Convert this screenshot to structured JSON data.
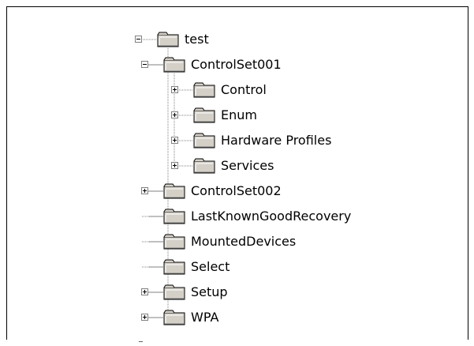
{
  "tree": {
    "items": [
      {
        "label": "test",
        "depth": 0,
        "state": "expanded"
      },
      {
        "label": "ControlSet001",
        "depth": 1,
        "state": "expanded"
      },
      {
        "label": "Control",
        "depth": 2,
        "state": "collapsed"
      },
      {
        "label": "Enum",
        "depth": 2,
        "state": "collapsed"
      },
      {
        "label": "Hardware Profiles",
        "depth": 2,
        "state": "collapsed"
      },
      {
        "label": "Services",
        "depth": 2,
        "state": "collapsed"
      },
      {
        "label": "ControlSet002",
        "depth": 1,
        "state": "collapsed"
      },
      {
        "label": "LastKnownGoodRecovery",
        "depth": 1,
        "state": "leaf"
      },
      {
        "label": "MountedDevices",
        "depth": 1,
        "state": "leaf"
      },
      {
        "label": "Select",
        "depth": 1,
        "state": "leaf"
      },
      {
        "label": "Setup",
        "depth": 1,
        "state": "collapsed"
      },
      {
        "label": "WPA",
        "depth": 1,
        "state": "collapsed"
      }
    ]
  },
  "icons": {
    "folder": "folder-icon",
    "expand": "plus-expander-icon",
    "collapse": "minus-expander-icon"
  },
  "colors": {
    "background": "#ffffff",
    "border": "#000000",
    "connector": "#808080",
    "folder_fill": "#d4d0c8"
  }
}
